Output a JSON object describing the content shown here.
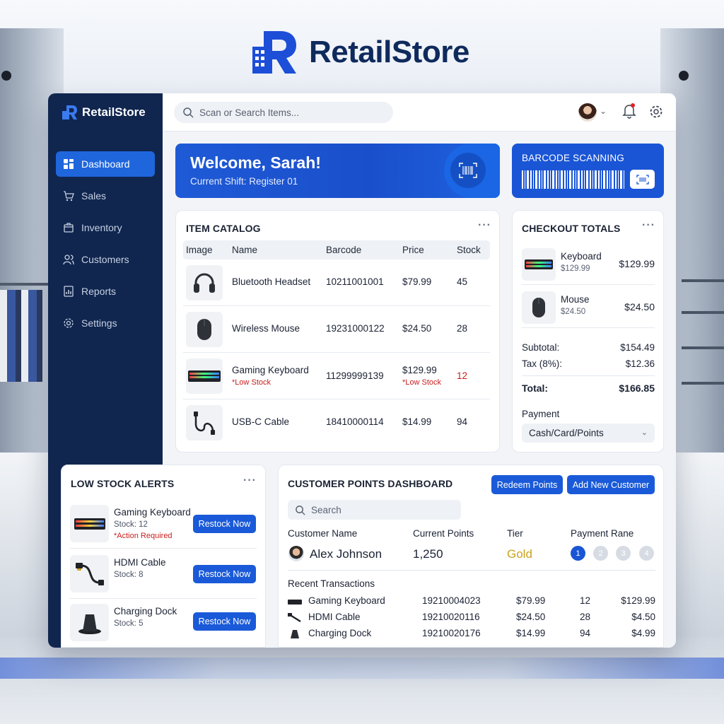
{
  "brand": {
    "name": "RetailStore"
  },
  "sidebar": {
    "brand": "RetailStore",
    "items": [
      {
        "label": "Dashboard",
        "icon": "dashboard-icon",
        "active": true
      },
      {
        "label": "Sales",
        "icon": "cart-icon"
      },
      {
        "label": "Inventory",
        "icon": "box-icon"
      },
      {
        "label": "Customers",
        "icon": "users-icon"
      },
      {
        "label": "Reports",
        "icon": "chart-icon"
      },
      {
        "label": "Settings",
        "icon": "gear-icon"
      }
    ]
  },
  "topbar": {
    "search_placeholder": "Scan or Search Items..."
  },
  "welcome": {
    "title": "Welcome, Sarah!",
    "subtitle": "Current Shift: Register 01"
  },
  "barcode": {
    "title": "BARCODE SCANNING"
  },
  "catalog": {
    "title": "ITEM CATALOG",
    "columns": [
      "Image",
      "Name",
      "Barcode",
      "Price",
      "Stock"
    ],
    "rows": [
      {
        "name": "Bluetooth Headset",
        "barcode": "10211001001",
        "price": "$79.99",
        "stock": "45",
        "icon": "headset-icon"
      },
      {
        "name": "Wireless Mouse",
        "barcode": "19231000122",
        "price": "$24.50",
        "stock": "28",
        "icon": "mouse-icon"
      },
      {
        "name": "Gaming Keyboard",
        "note": "*Low Stock",
        "barcode": "11299999139",
        "price": "$129.99",
        "price_note": "*Low Stock",
        "stock": "12",
        "icon": "keyboard-icon"
      },
      {
        "name": "USB-C Cable",
        "barcode": "18410000114",
        "price": "$14.99",
        "stock": "94",
        "icon": "cable-icon"
      }
    ]
  },
  "checkout": {
    "title": "CHECKOUT TOTALS",
    "items": [
      {
        "name": "Keyboard",
        "unit": "$129.99",
        "price": "$129.99"
      },
      {
        "name": "Mouse",
        "unit": "$24.50",
        "price": "$24.50"
      }
    ],
    "subtotal_label": "Subtotal:",
    "subtotal": "$154.49",
    "tax_label": "Tax (8%):",
    "tax": "$12.36",
    "total_label": "Total:",
    "total": "$166.85",
    "payment_label": "Payment",
    "payment_value": "Cash/Card/Points"
  },
  "low_stock": {
    "title": "LOW STOCK ALERTS",
    "button_label": "Restock Now",
    "items": [
      {
        "name": "Gaming Keyboard",
        "stock": "Stock: 12",
        "warning": "*Action Required"
      },
      {
        "name": "HDMI Cable",
        "stock": "Stock: 8"
      },
      {
        "name": "Charging Dock",
        "stock": "Stock: 5"
      }
    ]
  },
  "points": {
    "title": "CUSTOMER POINTS DASHBOARD",
    "redeem_label": "Redeem Points",
    "add_label": "Add New Customer",
    "search_placeholder": "Search",
    "columns": [
      "Customer Name",
      "Current Points",
      "Tier",
      "Payment Rane"
    ],
    "customer": {
      "name": "Alex Johnson",
      "points": "1,250",
      "tier": "Gold"
    },
    "pages": [
      "1",
      "2",
      "3",
      "4"
    ],
    "recent_title": "Recent Transactions",
    "transactions": [
      {
        "name": "Gaming Keyboard",
        "barcode": "19210004023",
        "price": "$79.99",
        "qty": "12",
        "total": "$129.99"
      },
      {
        "name": "HDMI Cable",
        "barcode": "19210020116",
        "price": "$24.50",
        "qty": "28",
        "total": "$4.50"
      },
      {
        "name": "Charging Dock",
        "barcode": "19210020176",
        "price": "$14.99",
        "qty": "94",
        "total": "$4.99"
      }
    ]
  },
  "colors": {
    "accent": "#1f66dc",
    "sidebar": "#10264f",
    "warning": "#c81e1e",
    "gold": "#c9a21c"
  }
}
